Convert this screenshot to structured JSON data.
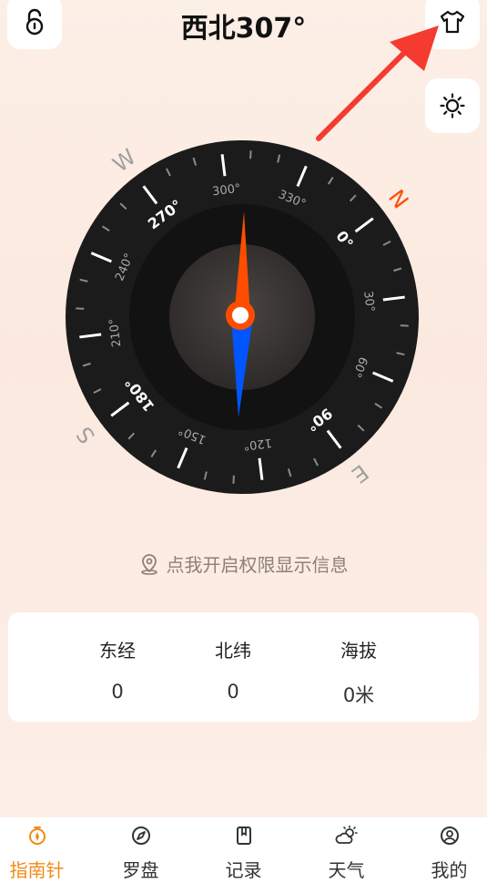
{
  "header": {
    "title": "西北307°"
  },
  "compass": {
    "cardinals": {
      "north": "N",
      "east": "E",
      "south": "S",
      "west": "W"
    },
    "tick_labels": [
      "0°",
      "30°",
      "60°",
      "90°",
      "120°",
      "150°",
      "180°",
      "210°",
      "240°",
      "270°",
      "300°",
      "330°"
    ],
    "heading_degrees": 307
  },
  "permission": {
    "text": "点我开启权限显示信息"
  },
  "info": {
    "longitude_label": "东经",
    "longitude_value": "0",
    "latitude_label": "北纬",
    "latitude_value": "0",
    "altitude_label": "海拔",
    "altitude_value": "0米"
  },
  "tabs": [
    {
      "label": "指南针",
      "icon": "compass-timer-icon",
      "active": true
    },
    {
      "label": "罗盘",
      "icon": "compass-icon",
      "active": false
    },
    {
      "label": "记录",
      "icon": "bookmark-icon",
      "active": false
    },
    {
      "label": "天气",
      "icon": "weather-icon",
      "active": false
    },
    {
      "label": "我的",
      "icon": "user-icon",
      "active": false
    }
  ],
  "colors": {
    "accent": "#f28a17",
    "needle_north": "#ff4d00",
    "needle_south": "#0055ff",
    "arrow": "#f53b30"
  }
}
